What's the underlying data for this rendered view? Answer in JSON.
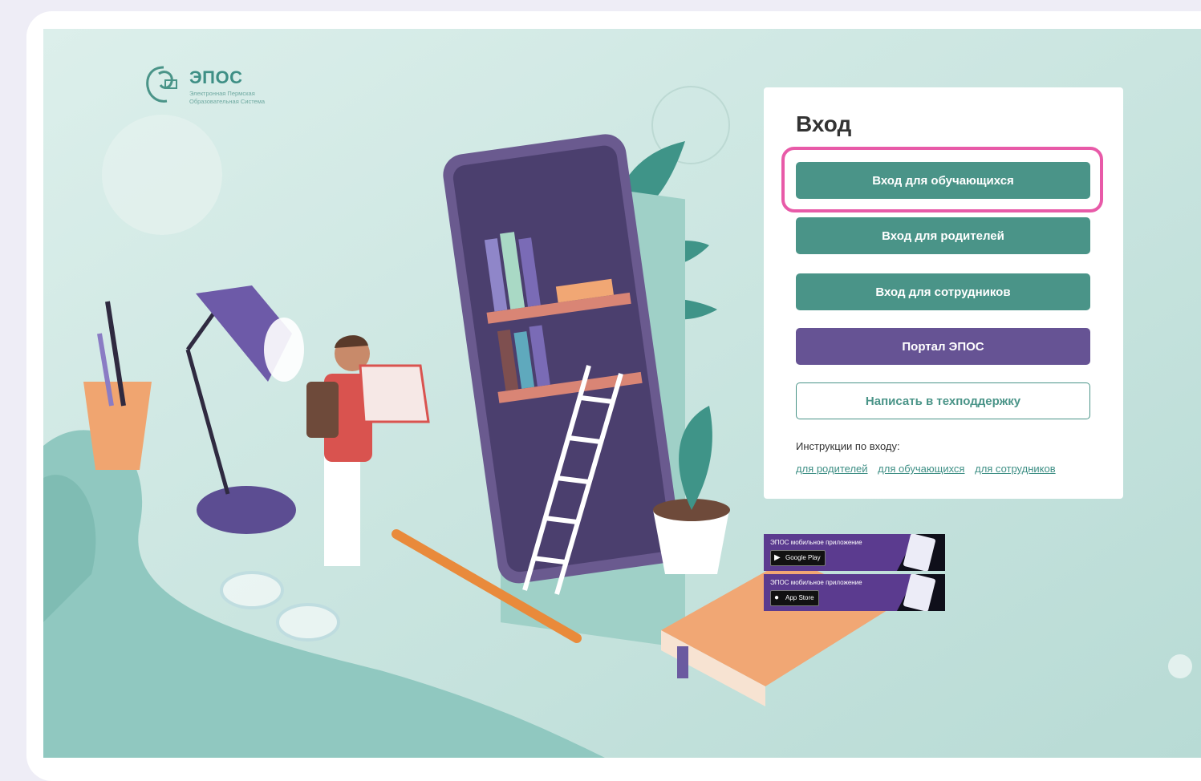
{
  "logo": {
    "brand": "ЭПОС",
    "subtitle_line1": "Электронная Пермская",
    "subtitle_line2": "Образовательная Система"
  },
  "login": {
    "title": "Вход",
    "buttons": {
      "students": "Вход для обучающихся",
      "parents": "Вход для родителей",
      "staff": "Вход для сотрудников",
      "portal": "Портал ЭПОС",
      "support": "Написать в техподдержку"
    },
    "instructions_label": "Инструкции по входу:",
    "instruction_links": [
      "для родителей",
      "для обучающихся",
      "для сотрудников"
    ]
  },
  "apps": {
    "google_play": {
      "title": "ЭПОС мобильное приложение",
      "store": "Google Play"
    },
    "app_store": {
      "title": "ЭПОС мобильное приложение",
      "store": "App Store"
    }
  },
  "colors": {
    "teal": "#4a9488",
    "purple": "#665394",
    "highlight": "#e85aa8",
    "background": "#c6e2dd"
  }
}
